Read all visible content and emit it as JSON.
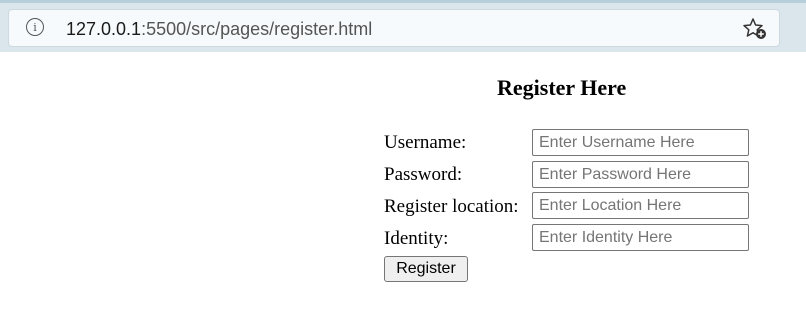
{
  "browser": {
    "url_host": "127.0.0.1",
    "url_rest": ":5500/src/pages/register.html",
    "info_icon": "info-icon",
    "bookmark_icon": "star-add-icon"
  },
  "form": {
    "title": "Register Here",
    "fields": [
      {
        "label": "Username:",
        "placeholder": "Enter Username Here",
        "value": ""
      },
      {
        "label": "Password:",
        "placeholder": "Enter Password Here",
        "value": ""
      },
      {
        "label": "Register location:",
        "placeholder": "Enter Location Here",
        "value": ""
      },
      {
        "label": "Identity:",
        "placeholder": "Enter Identity Here",
        "value": ""
      }
    ],
    "submit_label": "Register"
  }
}
